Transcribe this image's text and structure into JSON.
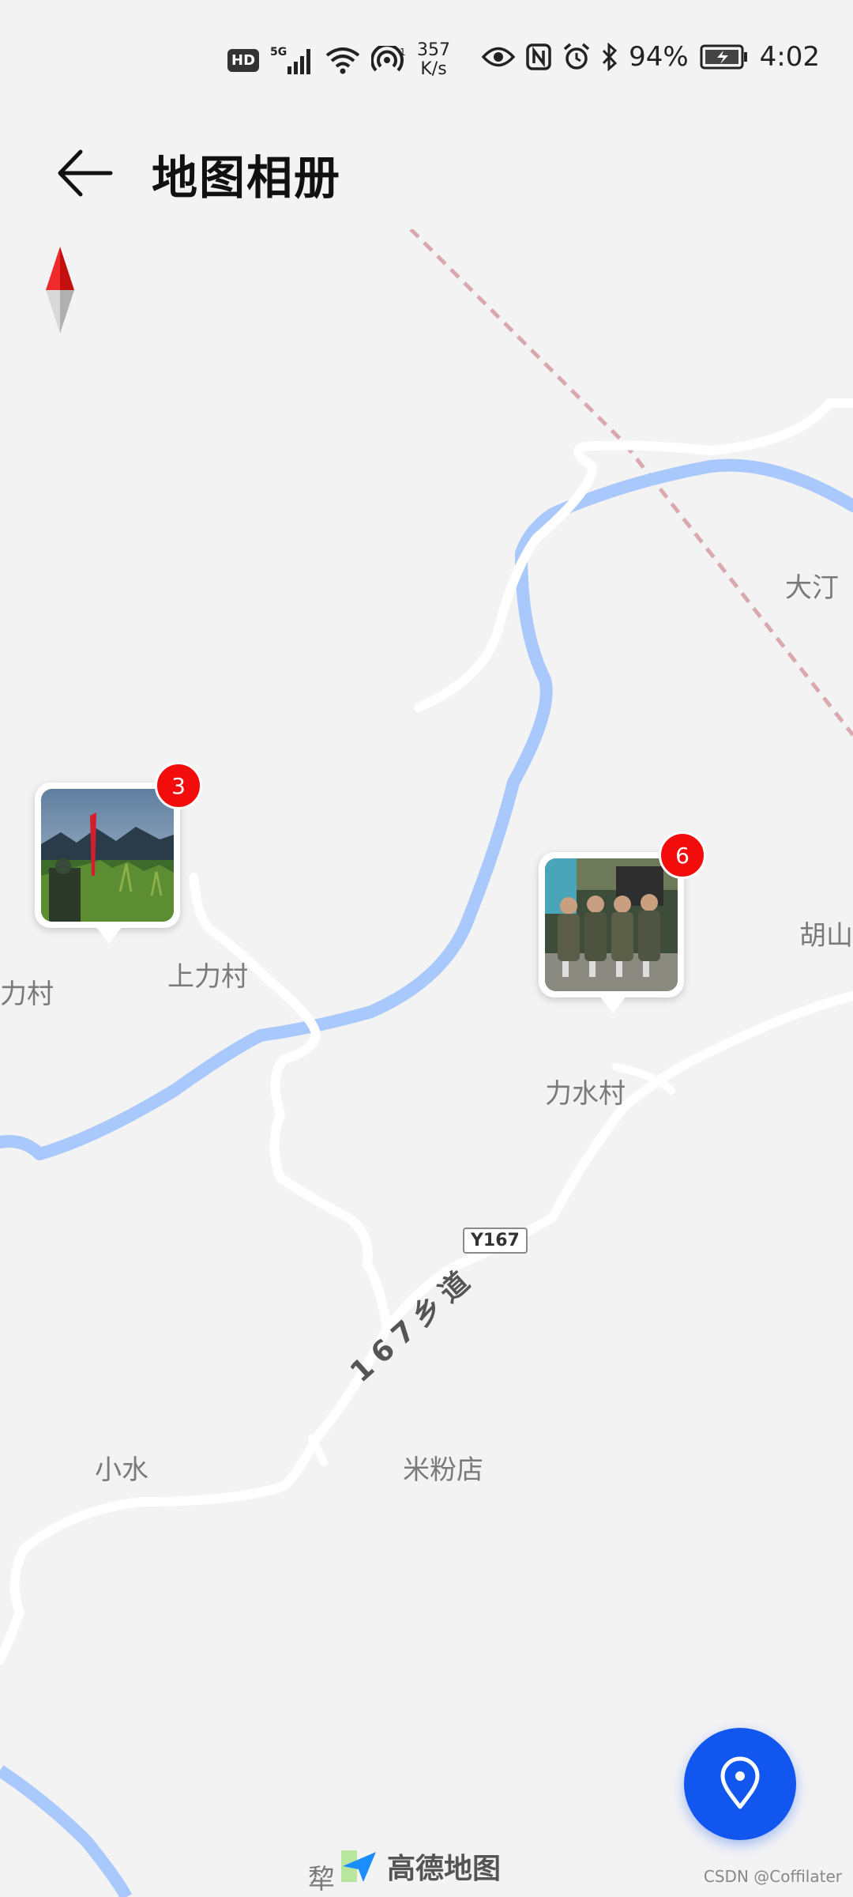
{
  "status_bar": {
    "hd_label": "HD",
    "network": "5G",
    "speed_value": "357",
    "speed_unit": "K/s",
    "battery": "94%",
    "time": "4:02"
  },
  "header": {
    "title": "地图相册",
    "back_icon": "arrow-left-icon"
  },
  "map": {
    "places": [
      "大汀",
      "胡山",
      "上力村",
      "力村",
      "力水村",
      "小水",
      "米粉店",
      "犂"
    ],
    "road_badge": "Y167",
    "road_name": "167乡道",
    "compass_icon": "compass-icon"
  },
  "pins": [
    {
      "count": "3",
      "photo": "corn-field-photo"
    },
    {
      "count": "6",
      "photo": "group-camo-photo"
    }
  ],
  "fab": {
    "icon": "location-pin-icon",
    "color": "#1256f0"
  },
  "attribution": {
    "amap": "高德地图",
    "watermark": "CSDN @Coffilater"
  },
  "colors": {
    "river": "#a9c8fb",
    "badge": "#f20c0c",
    "road": "#ffffff",
    "railway": "#d9a9ae"
  }
}
